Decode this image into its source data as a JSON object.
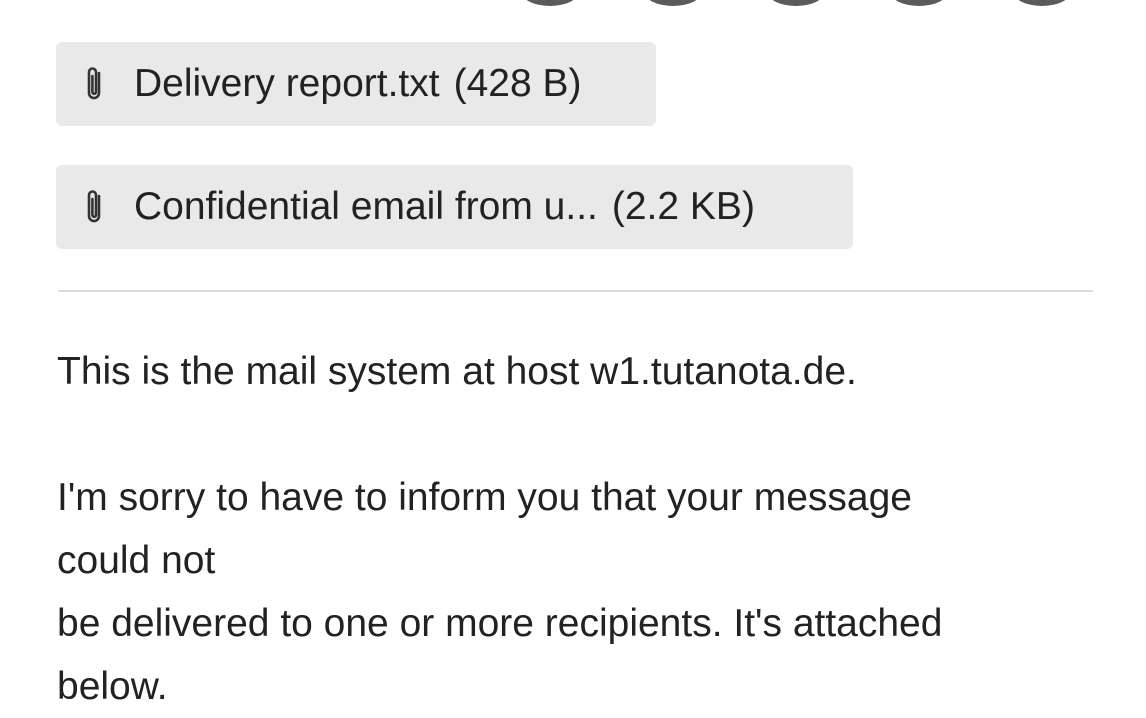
{
  "toolbar": {
    "action_icons": [
      "action-icon-1",
      "action-icon-2",
      "action-icon-3",
      "action-icon-4",
      "action-icon-5"
    ]
  },
  "attachments": [
    {
      "name": "Delivery report.txt",
      "size": "(428 B)",
      "icon": "paperclip-icon"
    },
    {
      "name": "Confidential email from u...",
      "size": "(2.2 KB)",
      "icon": "paperclip-icon"
    }
  ],
  "message": {
    "line1": "This is the mail system at host w1.tutanota.de.",
    "line2": "I'm sorry to have to inform you that your message",
    "line3": "could not",
    "line4": "be delivered to one or more recipients. It's attached",
    "line5": "below."
  },
  "colors": {
    "chip_background": "#e9e9e9",
    "text": "#222222",
    "divider": "#dcdcdc"
  }
}
